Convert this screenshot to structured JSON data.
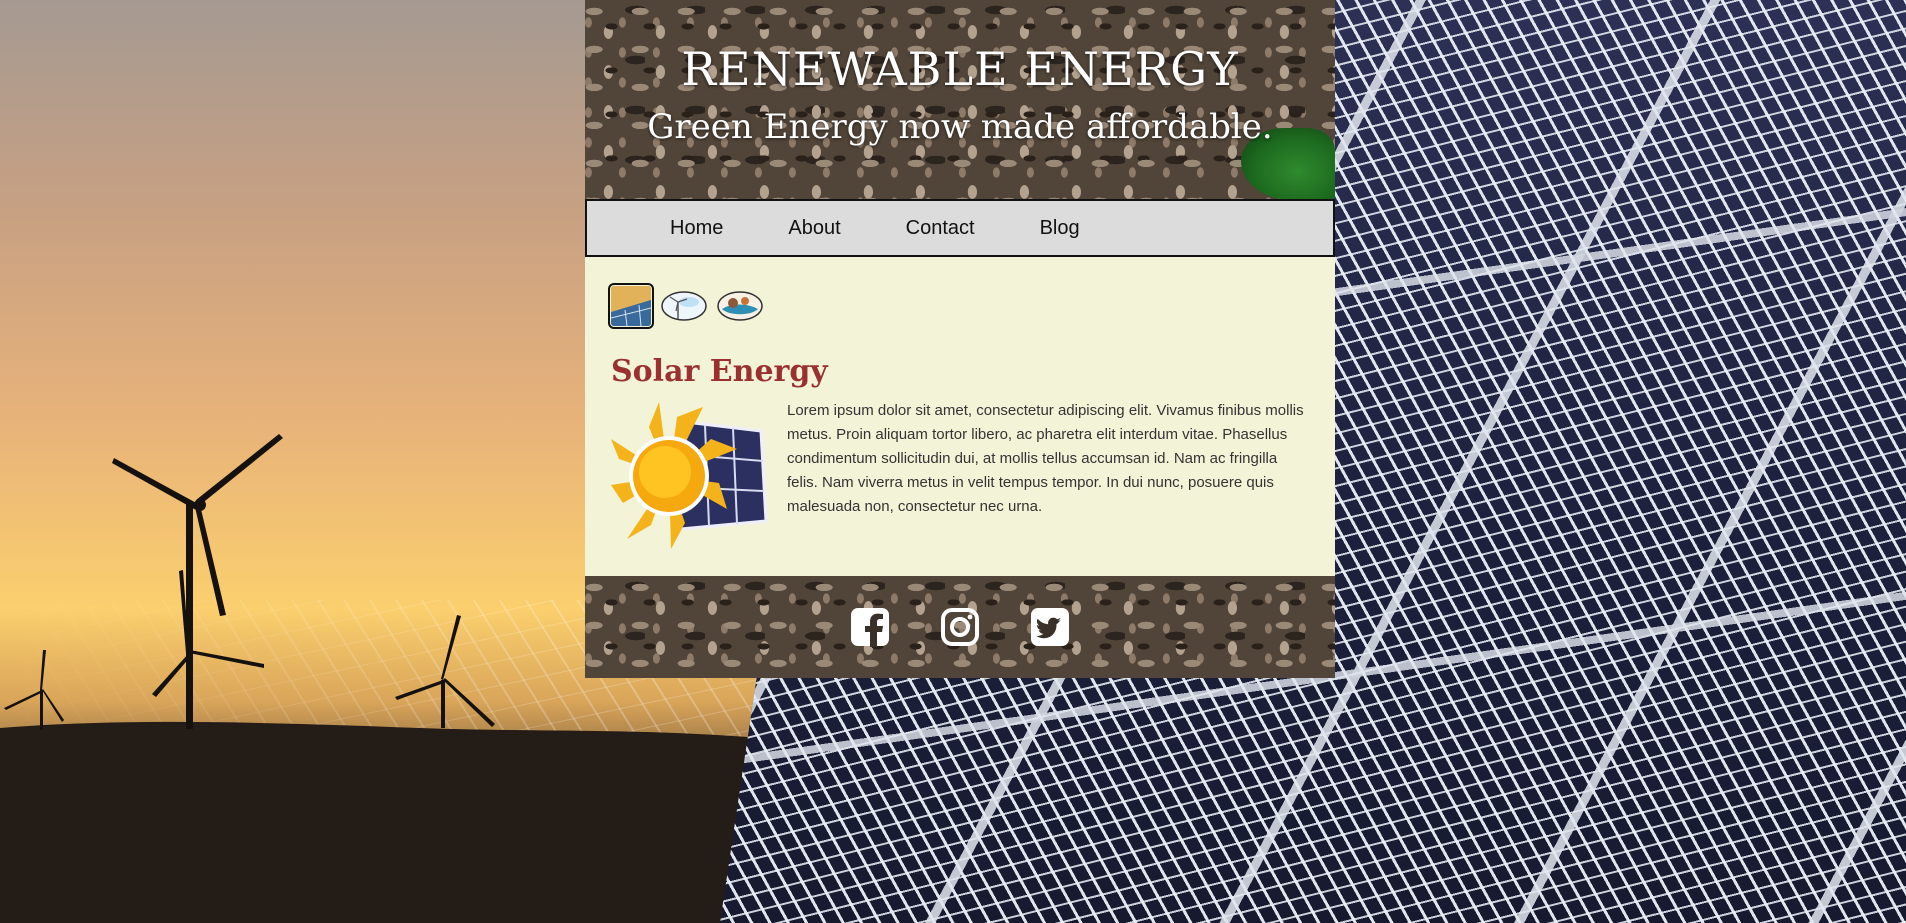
{
  "header": {
    "title": "RENEWABLE ENERGY",
    "tagline": "Green Energy now made affordable."
  },
  "nav": {
    "items": [
      {
        "label": "Home"
      },
      {
        "label": "About"
      },
      {
        "label": "Contact"
      },
      {
        "label": "Blog"
      }
    ]
  },
  "gallery": {
    "thumbnails": [
      {
        "icon": "solar-panel-thumbnail",
        "active": true
      },
      {
        "icon": "wind-turbine-thumbnail",
        "active": false
      },
      {
        "icon": "hydro-energy-thumbnail",
        "active": false
      }
    ]
  },
  "article": {
    "title": "Solar Energy",
    "illustration": "sun-and-solar-panel-icon",
    "body": "Lorem ipsum dolor sit amet, consectetur adipiscing elit. Vivamus finibus mollis metus. Proin aliquam tortor libero, ac pharetra elit interdum vitae. Phasellus condimentum sollicitudin dui, at mollis tellus accumsan id. Nam ac fringilla felis. Nam viverra metus in velit tempus tempor. In dui nunc, posuere quis malesuada non, consectetur nec urna."
  },
  "footer": {
    "social": [
      "facebook-icon",
      "instagram-icon",
      "twitter-icon"
    ]
  },
  "colors": {
    "nav_background": "#dcdcdc",
    "content_background": "#f3f3d8",
    "section_title": "#9b3031"
  }
}
